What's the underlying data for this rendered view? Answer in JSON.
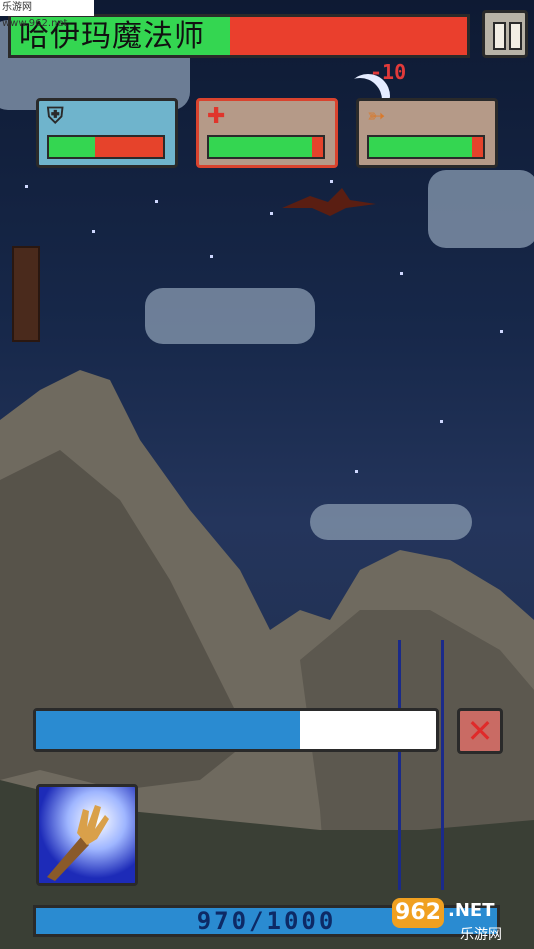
{
  "boss": {
    "name": "哈伊玛魔法师",
    "health_fraction": 0.48
  },
  "damage_popup": "-10",
  "stats": [
    {
      "icon": "helmet-icon",
      "glyph": "⛨",
      "fill_fraction": 0.4,
      "card_color": "#6fb4cc",
      "icon_color": "#2a2a2a",
      "border_color": "#2a2a2a"
    },
    {
      "icon": "health-cross-icon",
      "glyph": "✚",
      "fill_fraction": 0.9,
      "card_color": "#b59a88",
      "icon_color": "#e0352b",
      "border_color": "#d9432e"
    },
    {
      "icon": "bow-icon",
      "glyph": "➳",
      "fill_fraction": 0.9,
      "card_color": "#b59a88",
      "icon_color": "#d9792b",
      "border_color": "#2a2a2a"
    }
  ],
  "cast_charge_fraction": 0.66,
  "mana_text": "970/1000",
  "watermark_top": "乐游网 www.962.net",
  "watermark_bottom": {
    "main": "962",
    "suffix": ".NET",
    "sub": "乐游网"
  },
  "colors": {
    "health_green": "#34d651",
    "damage_red": "#e6432b",
    "mana_blue": "#2a8bd1"
  }
}
